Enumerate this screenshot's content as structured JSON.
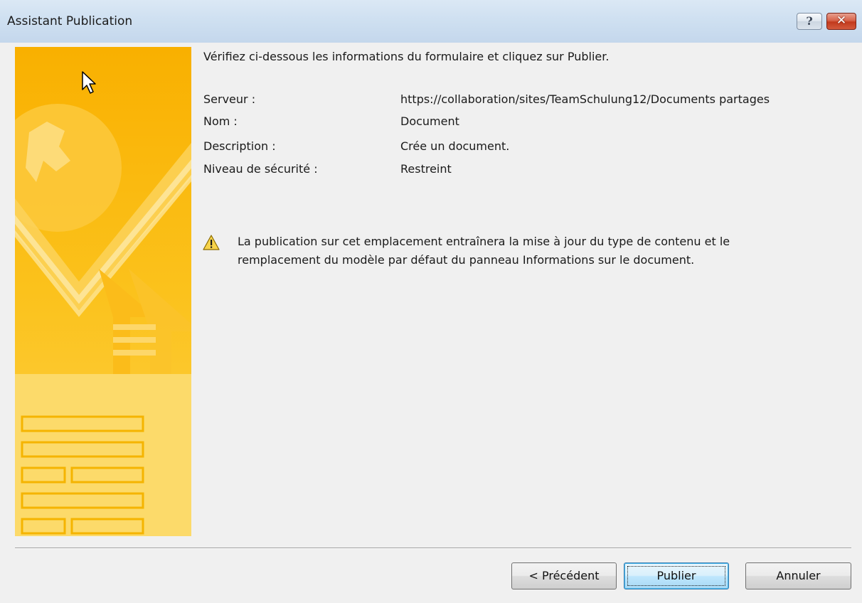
{
  "window": {
    "title": "Assistant Publication"
  },
  "titlebar": {
    "help_label": "?",
    "close_label": "✕"
  },
  "instruction": "Vérifiez ci-dessous les informations du formulaire et cliquez sur Publier.",
  "fields": [
    {
      "label": "Serveur :",
      "value": "https://collaboration/sites/TeamSchulung12/Documents partages"
    },
    {
      "label": "Nom :",
      "value": "Document"
    },
    {
      "label": "Description :",
      "value": "Crée un document."
    },
    {
      "label": "Niveau de sécurité :",
      "value": "Restreint"
    }
  ],
  "warning": {
    "icon": "warning-triangle-icon",
    "text": "La publication sur cet emplacement entraînera la mise à jour du type de contenu et le remplacement du modèle par défaut du panneau Informations sur le document."
  },
  "buttons": {
    "previous": "< Précédent",
    "publish": "Publier",
    "cancel": "Annuler"
  },
  "colors": {
    "banner": "#f7b500",
    "titlebar": "#cfe0f1",
    "dialog": "#f0f0f0",
    "focused_button": "#bee6fd"
  }
}
